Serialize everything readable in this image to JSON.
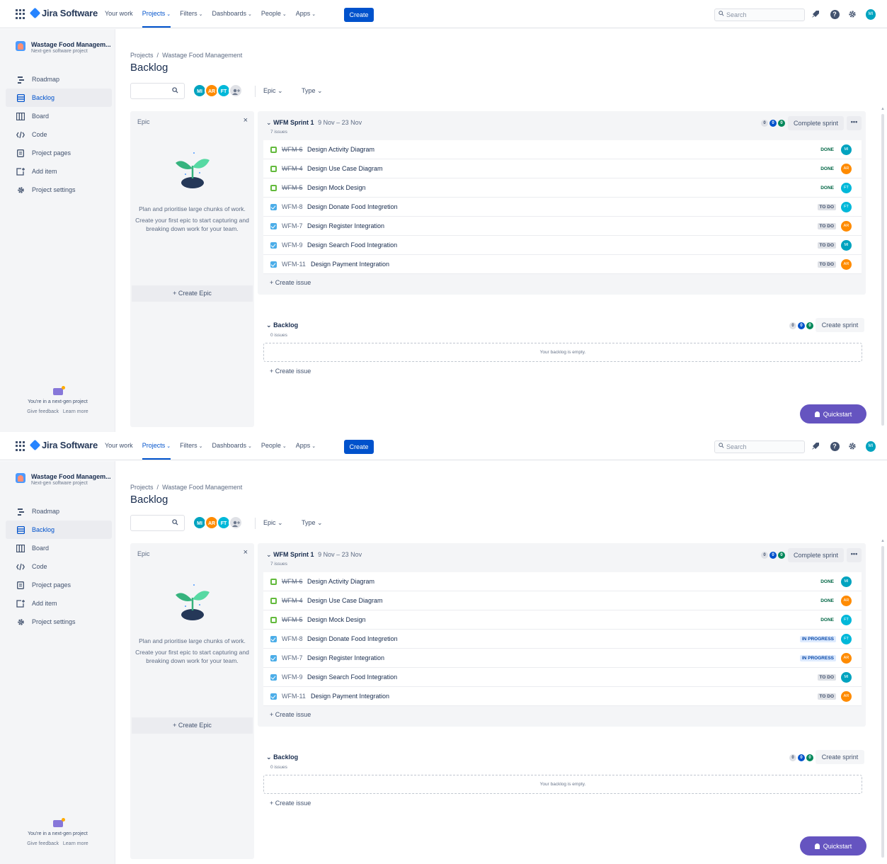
{
  "nav": {
    "brand": "Jira Software",
    "menu": [
      {
        "label": "Your work",
        "chevron": ""
      },
      {
        "label": "Projects",
        "chevron": "⌄"
      },
      {
        "label": "Filters",
        "chevron": "⌄"
      },
      {
        "label": "Dashboards",
        "chevron": "⌄"
      },
      {
        "label": "People",
        "chevron": "⌄"
      },
      {
        "label": "Apps",
        "chevron": "⌄"
      }
    ],
    "create_label": "Create",
    "search_placeholder": "Search",
    "user_initials": "MI"
  },
  "sidebar": {
    "project_name": "Wastage Food Managem...",
    "project_type": "Next-gen software project",
    "items": [
      "Roadmap",
      "Backlog",
      "Board",
      "Code",
      "Project pages",
      "Add item",
      "Project settings"
    ],
    "footer_text": "You're in a next-gen project",
    "feedback": "Give feedback",
    "learn_more": "Learn more"
  },
  "main": {
    "breadcrumb_projects": "Projects",
    "breadcrumb_sep": "/",
    "breadcrumb_project": "Wastage Food Management",
    "title": "Backlog",
    "avatars": [
      {
        "initials": "MI",
        "color": "#00a3bf"
      },
      {
        "initials": "AR",
        "color": "#ff8b00"
      },
      {
        "initials": "FT",
        "color": "#00b8d9"
      }
    ],
    "filter_epic": "Epic",
    "filter_type": "Type"
  },
  "epic_panel": {
    "heading": "Epic",
    "close": "×",
    "text1": "Plan and prioritise large chunks of work.",
    "text2": "Create your first epic to start capturing and breaking down work for your team.",
    "create_label": "+  Create Epic"
  },
  "sprint": {
    "name": "WFM Sprint 1",
    "dates": "9 Nov – 23 Nov",
    "issue_count": "7 issues",
    "counts": [
      "0",
      "0",
      "0"
    ],
    "complete_label": "Complete sprint",
    "more_label": "•••",
    "create_issue": "+   Create issue"
  },
  "screens": [
    {
      "issues": [
        {
          "type": "story",
          "key": "WFM-6",
          "summary": "Design Activity Diagram",
          "status": "DONE",
          "status_class": "done",
          "assignee": "MI",
          "color": "#00a3bf"
        },
        {
          "type": "story",
          "key": "WFM-4",
          "summary": "Design Use Case Diagram",
          "status": "DONE",
          "status_class": "done",
          "assignee": "AR",
          "color": "#ff8b00"
        },
        {
          "type": "story",
          "key": "WFM-5",
          "summary": "Design Mock Design",
          "status": "DONE",
          "status_class": "done",
          "assignee": "FT",
          "color": "#00b8d9"
        },
        {
          "type": "task",
          "key": "WFM-8",
          "summary": "Design Donate Food Integretion",
          "status": "TO DO",
          "status_class": "todo",
          "assignee": "FT",
          "color": "#00b8d9"
        },
        {
          "type": "task",
          "key": "WFM-7",
          "summary": "Design Register Integration",
          "status": "TO DO",
          "status_class": "todo",
          "assignee": "AR",
          "color": "#ff8b00"
        },
        {
          "type": "task",
          "key": "WFM-9",
          "summary": "Design Search Food Integration",
          "status": "TO DO",
          "status_class": "todo",
          "assignee": "MI",
          "color": "#00a3bf"
        },
        {
          "type": "task",
          "key": "WFM-11",
          "summary": "Design Payment Integration",
          "status": "TO DO",
          "status_class": "todo",
          "assignee": "AR",
          "color": "#ff8b00"
        }
      ]
    },
    {
      "issues": [
        {
          "type": "story",
          "key": "WFM-6",
          "summary": "Design Activity Diagram",
          "status": "DONE",
          "status_class": "done",
          "assignee": "MI",
          "color": "#00a3bf"
        },
        {
          "type": "story",
          "key": "WFM-4",
          "summary": "Design Use Case Diagram",
          "status": "DONE",
          "status_class": "done",
          "assignee": "AR",
          "color": "#ff8b00"
        },
        {
          "type": "story",
          "key": "WFM-5",
          "summary": "Design Mock Design",
          "status": "DONE",
          "status_class": "done",
          "assignee": "FT",
          "color": "#00b8d9"
        },
        {
          "type": "task",
          "key": "WFM-8",
          "summary": "Design Donate Food Integretion",
          "status": "IN PROGRESS",
          "status_class": "prog",
          "assignee": "FT",
          "color": "#00b8d9"
        },
        {
          "type": "task",
          "key": "WFM-7",
          "summary": "Design Register Integration",
          "status": "IN PROGRESS",
          "status_class": "prog",
          "assignee": "AR",
          "color": "#ff8b00"
        },
        {
          "type": "task",
          "key": "WFM-9",
          "summary": "Design Search Food Integration",
          "status": "TO DO",
          "status_class": "todo",
          "assignee": "MI",
          "color": "#00a3bf"
        },
        {
          "type": "task",
          "key": "WFM-11",
          "summary": "Design Payment Integration",
          "status": "TO DO",
          "status_class": "todo",
          "assignee": "AR",
          "color": "#ff8b00"
        }
      ]
    }
  ],
  "backlog": {
    "name": "Backlog",
    "issue_count": "0 issues",
    "counts": [
      "0",
      "0",
      "0"
    ],
    "create_sprint": "Create sprint",
    "empty_text": "Your backlog is empty.",
    "create_issue": "+   Create issue"
  },
  "quickstart": "Quickstart"
}
